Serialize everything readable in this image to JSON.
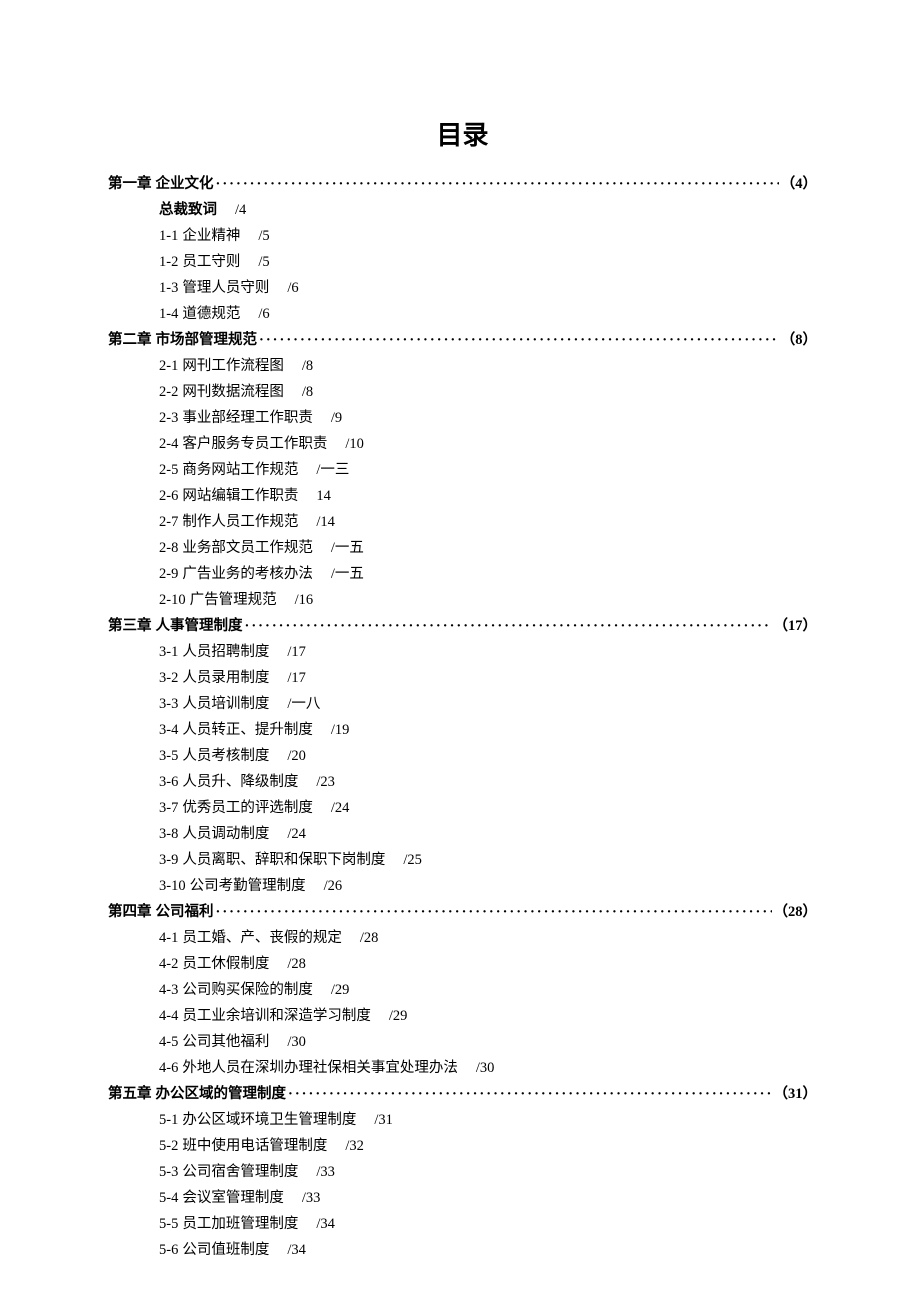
{
  "title": "目录",
  "dots": "·······································································································································································",
  "chapters": [
    {
      "label": "第一章",
      "name": "企业文化",
      "page": "（4）",
      "intro": {
        "name": "总裁致词",
        "page": "/4"
      },
      "items": [
        {
          "idx": "1-1",
          "name": "企业精神",
          "page": "/5"
        },
        {
          "idx": "1-2",
          "name": "员工守则",
          "page": "/5"
        },
        {
          "idx": "1-3",
          "name": "管理人员守则",
          "page": "/6"
        },
        {
          "idx": "1-4",
          "name": "道德规范",
          "page": "/6"
        }
      ]
    },
    {
      "label": "第二章",
      "name": "市场部管理规范",
      "page": "（8）",
      "items": [
        {
          "idx": "2-1",
          "name": "网刊工作流程图",
          "page": "/8"
        },
        {
          "idx": "2-2",
          "name": "网刊数据流程图",
          "page": "/8"
        },
        {
          "idx": "2-3",
          "name": "事业部经理工作职责",
          "page": "/9"
        },
        {
          "idx": "2-4",
          "name": "客户服务专员工作职责",
          "page": "/10"
        },
        {
          "idx": "2-5",
          "name": "商务网站工作规范",
          "page": "/一三"
        },
        {
          "idx": "2-6",
          "name": "网站编辑工作职责",
          "page": "14"
        },
        {
          "idx": "2-7",
          "name": "制作人员工作规范",
          "page": "/14"
        },
        {
          "idx": "2-8",
          "name": "业务部文员工作规范",
          "page": "/一五"
        },
        {
          "idx": "2-9",
          "name": "广告业务的考核办法",
          "page": "/一五"
        },
        {
          "idx": "2-10",
          "name": "广告管理规范",
          "page": "/16"
        }
      ]
    },
    {
      "label": "第三章",
      "name": "人事管理制度",
      "page": "（17）",
      "items": [
        {
          "idx": "3-1",
          "name": "人员招聘制度",
          "page": "/17"
        },
        {
          "idx": "3-2",
          "name": "人员录用制度",
          "page": "/17"
        },
        {
          "idx": "3-3",
          "name": "人员培训制度",
          "page": "/一八"
        },
        {
          "idx": "3-4",
          "name": "人员转正、提升制度",
          "page": "/19"
        },
        {
          "idx": "3-5",
          "name": "人员考核制度",
          "page": "/20"
        },
        {
          "idx": "3-6",
          "name": "人员升、降级制度",
          "page": "/23"
        },
        {
          "idx": "3-7",
          "name": "优秀员工的评选制度",
          "page": "/24"
        },
        {
          "idx": "3-8",
          "name": "人员调动制度",
          "page": "/24"
        },
        {
          "idx": "3-9",
          "name": "人员离职、辞职和保职下岗制度",
          "page": "/25"
        },
        {
          "idx": "3-10",
          "name": "公司考勤管理制度",
          "page": "/26"
        }
      ]
    },
    {
      "label": "第四章",
      "name": "公司福利",
      "page": "（28）",
      "items": [
        {
          "idx": "4-1",
          "name": "员工婚、产、丧假的规定",
          "page": "/28"
        },
        {
          "idx": "4-2",
          "name": "员工休假制度",
          "page": "/28"
        },
        {
          "idx": "4-3",
          "name": "公司购买保险的制度",
          "page": "/29"
        },
        {
          "idx": "4-4",
          "name": "员工业余培训和深造学习制度",
          "page": "/29"
        },
        {
          "idx": "4-5",
          "name": "公司其他福利",
          "page": "/30"
        },
        {
          "idx": "4-6",
          "name": "外地人员在深圳办理社保相关事宜处理办法",
          "page": "/30"
        }
      ]
    },
    {
      "label": "第五章",
      "name": "办公区域的管理制度",
      "page": "（31）",
      "items": [
        {
          "idx": "5-1",
          "name": "办公区域环境卫生管理制度",
          "page": "/31"
        },
        {
          "idx": "5-2",
          "name": "班中使用电话管理制度",
          "page": "/32"
        },
        {
          "idx": "5-3",
          "name": "公司宿舍管理制度",
          "page": "/33"
        },
        {
          "idx": "5-4",
          "name": "会议室管理制度",
          "page": "/33"
        },
        {
          "idx": "5-5",
          "name": "员工加班管理制度",
          "page": "/34"
        },
        {
          "idx": "5-6",
          "name": "公司值班制度",
          "page": "/34"
        }
      ]
    }
  ]
}
